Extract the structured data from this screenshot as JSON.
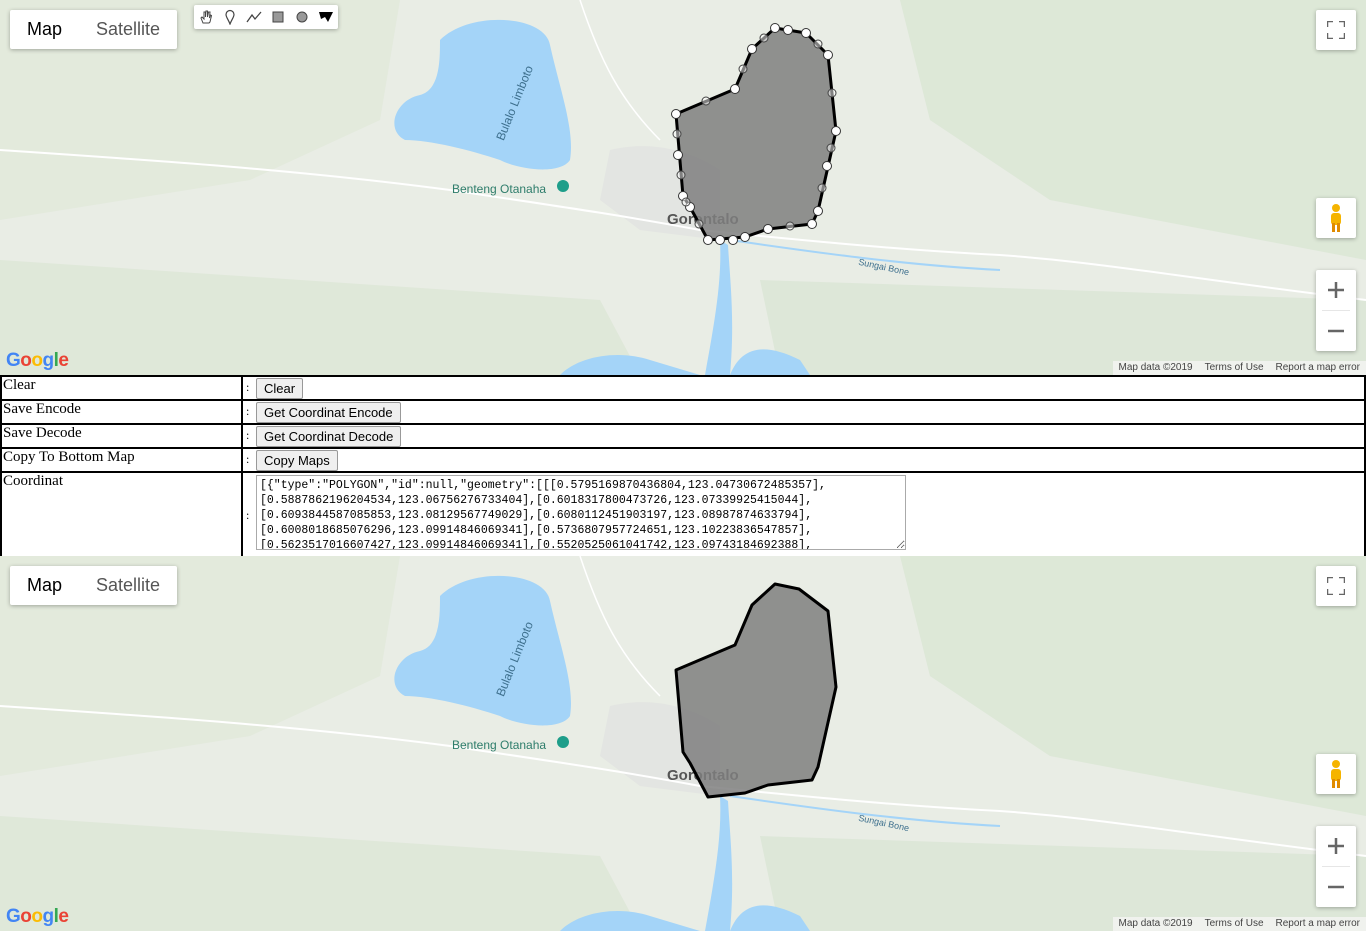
{
  "map_top": {
    "type_buttons": [
      "Map",
      "Satellite"
    ],
    "labels": {
      "lake": "Bulalo Limboto",
      "fort": "Benteng Otanaha",
      "city": "Gorontalo",
      "river": "Sungai Bone"
    },
    "google": "Google",
    "attribution": [
      "Map data ©2019",
      "Terms of Use",
      "Report a map error"
    ],
    "draw_tools": [
      "hand-icon",
      "marker-icon",
      "polyline-icon",
      "rectangle-icon",
      "circle-icon",
      "polygon-icon"
    ]
  },
  "map_bottom": {
    "type_buttons": [
      "Map",
      "Satellite"
    ],
    "labels": {
      "lake": "Bulalo Limboto",
      "fort": "Benteng Otanaha",
      "city": "Gorontalo",
      "river": "Sungai Bone"
    },
    "google": "Google",
    "attribution": [
      "Map data ©2019",
      "Terms of Use",
      "Report a map error"
    ]
  },
  "form": {
    "sep": ":",
    "rows": [
      {
        "label": "Clear",
        "button": "Clear"
      },
      {
        "label": "Save Encode",
        "button": "Get Coordinat Encode"
      },
      {
        "label": "Save Decode",
        "button": "Get Coordinat Decode"
      },
      {
        "label": "Copy To Bottom Map",
        "button": "Copy Maps"
      }
    ],
    "coord_label": "Coordinat",
    "coord_value": "[{\"type\":\"POLYGON\",\"id\":null,\"geometry\":[[[0.5795169870436804,123.04730672485357],\n[0.5887862196204534,123.06756276733404],[0.6018317800473726,123.07339925415044],\n[0.6093844587085853,123.08129567749029],[0.6080112451903197,123.08987874633794],\n[0.6008018685076296,123.09914846069341],[0.5736807957724651,123.10223836547857],\n[0.5623517016607427,123.09914846069341],[0.5520525061041742,123.09743184692388],"
  },
  "colors": {
    "water": "#a4d4f8",
    "land": "#e8ece4",
    "polygon_fill": "#7f7f7f"
  }
}
